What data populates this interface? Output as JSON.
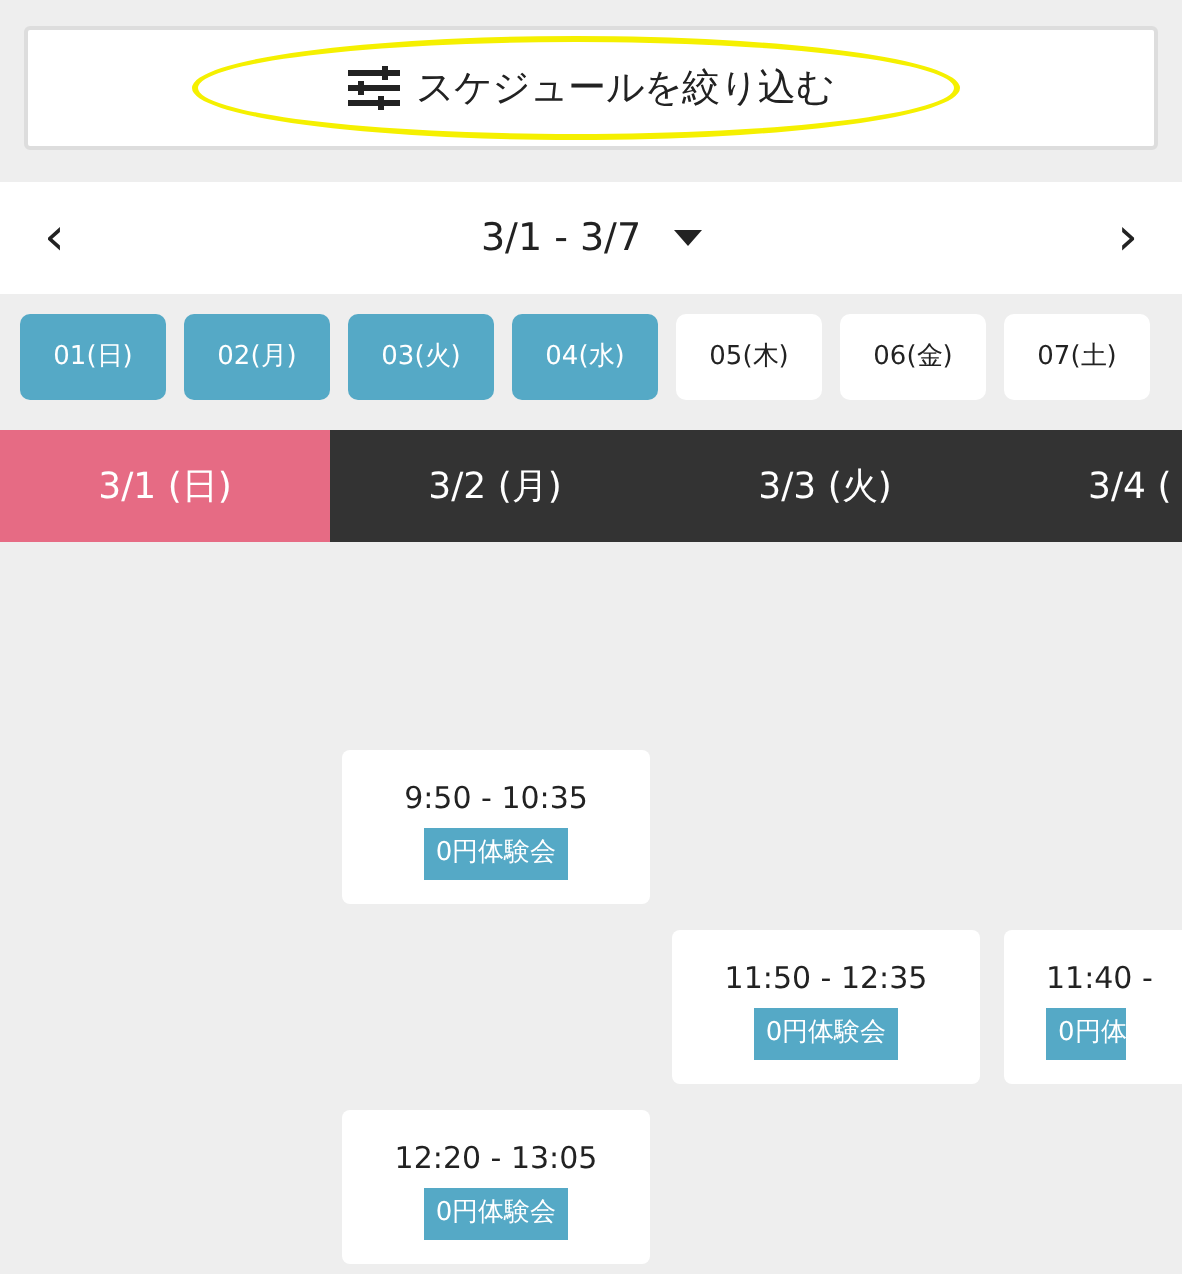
{
  "filter_button": {
    "label": "スケジュールを絞り込む",
    "highlighted": true
  },
  "week_nav": {
    "prev": "‹",
    "range": "3/1 - 3/7",
    "next": "›"
  },
  "day_chips": [
    {
      "label": "01(日)",
      "selected": true
    },
    {
      "label": "02(月)",
      "selected": true
    },
    {
      "label": "03(火)",
      "selected": true
    },
    {
      "label": "04(水)",
      "selected": true
    },
    {
      "label": "05(木)",
      "selected": false
    },
    {
      "label": "06(金)",
      "selected": false
    },
    {
      "label": "07(土)",
      "selected": false
    }
  ],
  "columns": [
    {
      "header": "3/1 (日)",
      "selected": true
    },
    {
      "header": "3/2 (月)",
      "selected": false,
      "sessions": [
        {
          "kind": "session",
          "time": "9:50 - 10:35",
          "tag": "0円体験会"
        },
        {
          "kind": "empty"
        },
        {
          "kind": "session",
          "time": "12:20 - 13:05",
          "tag": "0円体験会"
        }
      ]
    },
    {
      "header": "3/3 (火)",
      "selected": false,
      "sessions": [
        {
          "kind": "empty"
        },
        {
          "kind": "session",
          "time": "11:50 - 12:35",
          "tag": "0円体験会"
        }
      ]
    },
    {
      "header": "3/4 (",
      "selected": false,
      "sessions": [
        {
          "kind": "empty"
        },
        {
          "kind": "session",
          "time": "11:40 -",
          "tag": "0円体"
        }
      ]
    }
  ]
}
